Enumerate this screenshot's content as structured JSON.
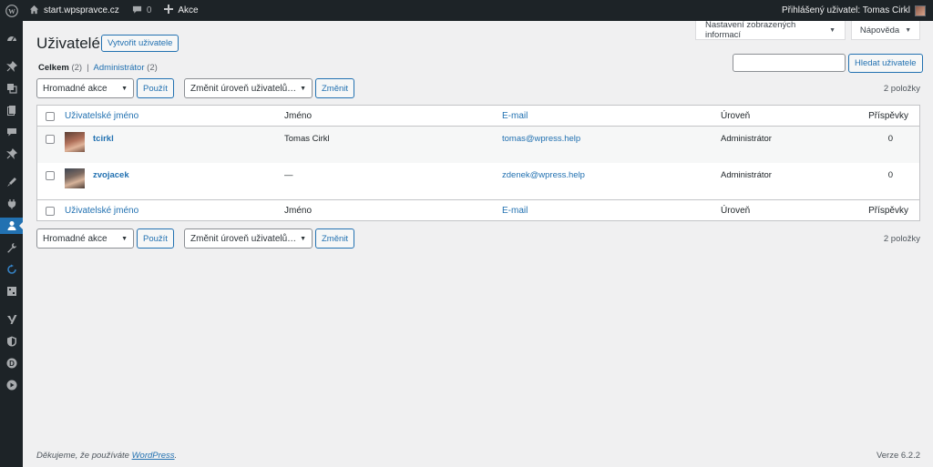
{
  "adminbar": {
    "wp_icon": "wordpress-logo-icon",
    "site_icon": "home-icon",
    "site_name": "start.wpspravce.cz",
    "comments_icon": "comment-bubble-icon",
    "comments_count": "0",
    "new_icon": "plus-icon",
    "new_label": "Akce",
    "greeting": "Přihlášený uživatel: Tomas Cirkl"
  },
  "sidebar": {
    "icons": [
      "dashboard-icon",
      "pin-icon",
      "media-icon",
      "pages-icon",
      "comments-icon",
      "pin-icon",
      "appearance-icon",
      "plugins-icon",
      "users-icon",
      "tools-icon",
      "refresh-icon",
      "settings-icon",
      "yoast-icon",
      "shield-icon",
      "d-icon",
      "play-icon"
    ]
  },
  "screen_meta": {
    "options_label": "Nastavení zobrazených informací",
    "help_label": "Nápověda"
  },
  "page": {
    "title": "Uživatelé",
    "add_new": "Vytvořit uživatele"
  },
  "filters": {
    "all_label": "Celkem",
    "all_count": "(2)",
    "separator": "|",
    "admin_label": "Administrátor",
    "admin_count": "(2)"
  },
  "search": {
    "value": "",
    "button": "Hledat uživatele"
  },
  "tablenav": {
    "bulk_action": "Hromadné akce",
    "apply": "Použít",
    "change_role": "Změnit úroveň uživatelů…",
    "change": "Změnit",
    "items_count": "2 položky"
  },
  "table": {
    "columns": {
      "username": "Uživatelské jméno",
      "name": "Jméno",
      "email": "E-mail",
      "role": "Úroveň",
      "posts": "Příspěvky"
    },
    "rows": [
      {
        "username": "tcirkl",
        "name": "Tomas Cirkl",
        "email": "tomas@wpress.help",
        "role": "Administrátor",
        "posts": "0"
      },
      {
        "username": "zvojacek",
        "name": "—",
        "email": "zdenek@wpress.help",
        "role": "Administrátor",
        "posts": "0"
      }
    ]
  },
  "footer": {
    "thanks_prefix": "Děkujeme, že používáte",
    "thanks_link": "WordPress",
    "thanks_suffix": ".",
    "version": "Verze 6.2.2"
  }
}
